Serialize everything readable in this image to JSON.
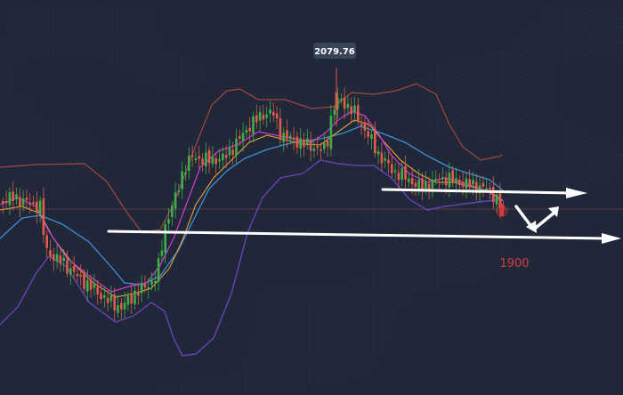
{
  "chart_data": {
    "type": "candlestick",
    "annotations": {
      "peak_label": "2079.76",
      "target_label": "1900"
    },
    "colors": {
      "background": "#1f2739",
      "up_candle": "#3fae49",
      "down_candle": "#e05c4b",
      "bollinger_upper": "#a5473f",
      "bollinger_lower": "#6a42b8",
      "ma_short": "#d23ad0",
      "ma_mid": "#e8a23a",
      "ma_long": "#3f8fd6",
      "trend_lines": "#ffffff",
      "target_label": "#d83b3b",
      "peak_label_bg": "#3a4457",
      "horizontal_reference": "#8a4a48"
    }
  }
}
